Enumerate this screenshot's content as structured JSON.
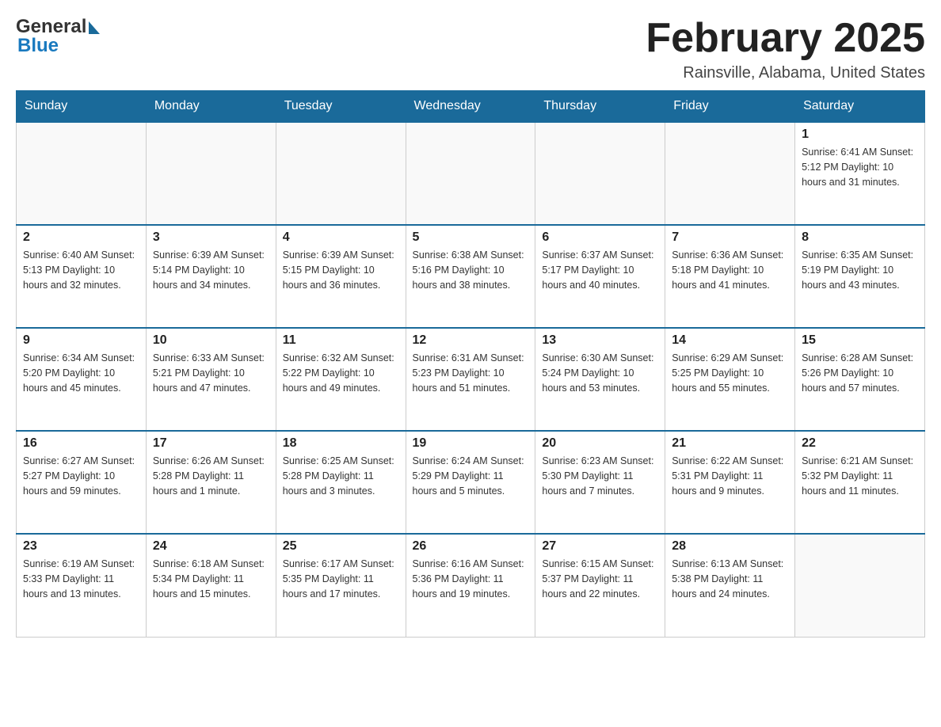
{
  "header": {
    "logo_line1": "General",
    "logo_arrow": "▶",
    "logo_line2": "Blue",
    "month_title": "February 2025",
    "location": "Rainsville, Alabama, United States"
  },
  "calendar": {
    "days_of_week": [
      "Sunday",
      "Monday",
      "Tuesday",
      "Wednesday",
      "Thursday",
      "Friday",
      "Saturday"
    ],
    "weeks": [
      [
        {
          "day": "",
          "info": ""
        },
        {
          "day": "",
          "info": ""
        },
        {
          "day": "",
          "info": ""
        },
        {
          "day": "",
          "info": ""
        },
        {
          "day": "",
          "info": ""
        },
        {
          "day": "",
          "info": ""
        },
        {
          "day": "1",
          "info": "Sunrise: 6:41 AM\nSunset: 5:12 PM\nDaylight: 10 hours and 31 minutes."
        }
      ],
      [
        {
          "day": "2",
          "info": "Sunrise: 6:40 AM\nSunset: 5:13 PM\nDaylight: 10 hours and 32 minutes."
        },
        {
          "day": "3",
          "info": "Sunrise: 6:39 AM\nSunset: 5:14 PM\nDaylight: 10 hours and 34 minutes."
        },
        {
          "day": "4",
          "info": "Sunrise: 6:39 AM\nSunset: 5:15 PM\nDaylight: 10 hours and 36 minutes."
        },
        {
          "day": "5",
          "info": "Sunrise: 6:38 AM\nSunset: 5:16 PM\nDaylight: 10 hours and 38 minutes."
        },
        {
          "day": "6",
          "info": "Sunrise: 6:37 AM\nSunset: 5:17 PM\nDaylight: 10 hours and 40 minutes."
        },
        {
          "day": "7",
          "info": "Sunrise: 6:36 AM\nSunset: 5:18 PM\nDaylight: 10 hours and 41 minutes."
        },
        {
          "day": "8",
          "info": "Sunrise: 6:35 AM\nSunset: 5:19 PM\nDaylight: 10 hours and 43 minutes."
        }
      ],
      [
        {
          "day": "9",
          "info": "Sunrise: 6:34 AM\nSunset: 5:20 PM\nDaylight: 10 hours and 45 minutes."
        },
        {
          "day": "10",
          "info": "Sunrise: 6:33 AM\nSunset: 5:21 PM\nDaylight: 10 hours and 47 minutes."
        },
        {
          "day": "11",
          "info": "Sunrise: 6:32 AM\nSunset: 5:22 PM\nDaylight: 10 hours and 49 minutes."
        },
        {
          "day": "12",
          "info": "Sunrise: 6:31 AM\nSunset: 5:23 PM\nDaylight: 10 hours and 51 minutes."
        },
        {
          "day": "13",
          "info": "Sunrise: 6:30 AM\nSunset: 5:24 PM\nDaylight: 10 hours and 53 minutes."
        },
        {
          "day": "14",
          "info": "Sunrise: 6:29 AM\nSunset: 5:25 PM\nDaylight: 10 hours and 55 minutes."
        },
        {
          "day": "15",
          "info": "Sunrise: 6:28 AM\nSunset: 5:26 PM\nDaylight: 10 hours and 57 minutes."
        }
      ],
      [
        {
          "day": "16",
          "info": "Sunrise: 6:27 AM\nSunset: 5:27 PM\nDaylight: 10 hours and 59 minutes."
        },
        {
          "day": "17",
          "info": "Sunrise: 6:26 AM\nSunset: 5:28 PM\nDaylight: 11 hours and 1 minute."
        },
        {
          "day": "18",
          "info": "Sunrise: 6:25 AM\nSunset: 5:28 PM\nDaylight: 11 hours and 3 minutes."
        },
        {
          "day": "19",
          "info": "Sunrise: 6:24 AM\nSunset: 5:29 PM\nDaylight: 11 hours and 5 minutes."
        },
        {
          "day": "20",
          "info": "Sunrise: 6:23 AM\nSunset: 5:30 PM\nDaylight: 11 hours and 7 minutes."
        },
        {
          "day": "21",
          "info": "Sunrise: 6:22 AM\nSunset: 5:31 PM\nDaylight: 11 hours and 9 minutes."
        },
        {
          "day": "22",
          "info": "Sunrise: 6:21 AM\nSunset: 5:32 PM\nDaylight: 11 hours and 11 minutes."
        }
      ],
      [
        {
          "day": "23",
          "info": "Sunrise: 6:19 AM\nSunset: 5:33 PM\nDaylight: 11 hours and 13 minutes."
        },
        {
          "day": "24",
          "info": "Sunrise: 6:18 AM\nSunset: 5:34 PM\nDaylight: 11 hours and 15 minutes."
        },
        {
          "day": "25",
          "info": "Sunrise: 6:17 AM\nSunset: 5:35 PM\nDaylight: 11 hours and 17 minutes."
        },
        {
          "day": "26",
          "info": "Sunrise: 6:16 AM\nSunset: 5:36 PM\nDaylight: 11 hours and 19 minutes."
        },
        {
          "day": "27",
          "info": "Sunrise: 6:15 AM\nSunset: 5:37 PM\nDaylight: 11 hours and 22 minutes."
        },
        {
          "day": "28",
          "info": "Sunrise: 6:13 AM\nSunset: 5:38 PM\nDaylight: 11 hours and 24 minutes."
        },
        {
          "day": "",
          "info": ""
        }
      ]
    ]
  }
}
